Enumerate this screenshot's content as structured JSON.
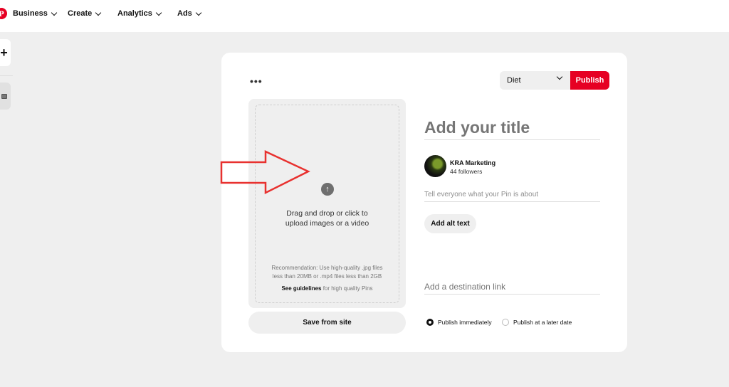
{
  "nav": {
    "logo": "P",
    "items": [
      "Business",
      "Create",
      "Analytics",
      "Ads"
    ]
  },
  "sidebar": {
    "add_symbol": "+"
  },
  "editor": {
    "more_symbol": "•••",
    "board_selected": "Diet",
    "publish_label": "Publish",
    "upload": {
      "main_text_line1": "Drag and drop or click to",
      "main_text_line2": "upload images or a video",
      "rec_line1": "Recommendation: Use high-quality .jpg files",
      "rec_line2": "less than 20MB or .mp4 files less than 2GB",
      "guide_link": "See guidelines",
      "guide_suffix": " for high quality Pins"
    },
    "save_from_site": "Save from site",
    "title_placeholder": "Add your title",
    "account": {
      "name": "KRA Marketing",
      "followers": "44 followers"
    },
    "about_placeholder": "Tell everyone what your Pin is about",
    "alt_text_button": "Add alt text",
    "destination_placeholder": "Add a destination link",
    "publish_options": [
      "Publish immediately",
      "Publish at a later date"
    ],
    "publish_selected": 0
  },
  "colors": {
    "brand": "#e60023",
    "annotation_arrow": "#e8312f"
  },
  "icons": {
    "logo": "pinterest-logo-icon",
    "upload": "arrow-up-circle-icon",
    "annotation": "right-arrow-outline-icon"
  }
}
